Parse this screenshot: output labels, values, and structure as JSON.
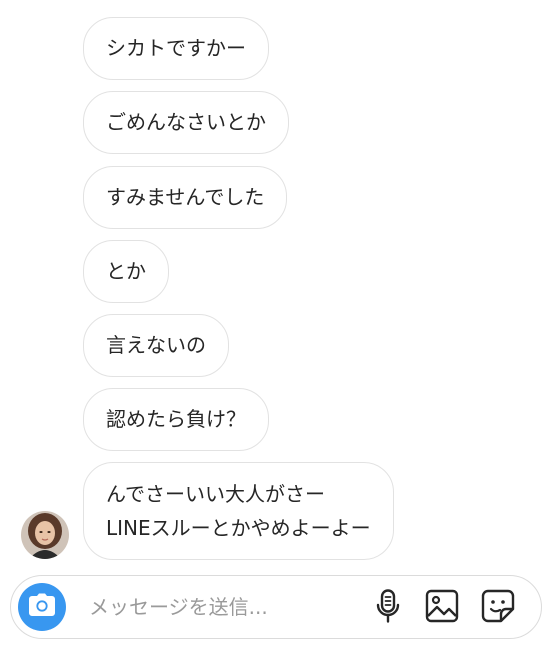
{
  "messages": [
    {
      "text": "シカトですかー"
    },
    {
      "text": "ごめんなさいとか"
    },
    {
      "text": "すみませんでした"
    },
    {
      "text": "とか"
    },
    {
      "text": "言えないの"
    },
    {
      "text": "認めたら負け？"
    },
    {
      "lines": [
        "んでさーいい大人がさー",
        "LINEスルーとかやめよーよー"
      ]
    }
  ],
  "composer": {
    "placeholder": "メッセージを送信..."
  },
  "icons": {
    "camera": "camera-icon",
    "mic": "microphone-icon",
    "gallery": "gallery-icon",
    "sticker": "sticker-icon"
  },
  "colors": {
    "accent": "#3897f0",
    "bubble_border": "#e2e2e2",
    "text": "#262626",
    "placeholder": "#9a9a9a"
  }
}
